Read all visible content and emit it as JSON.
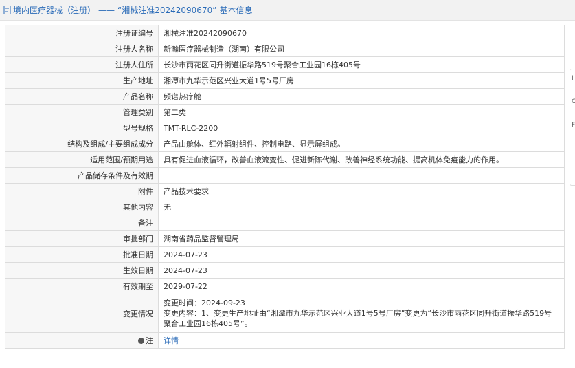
{
  "header": {
    "title": "境内医疗器械（注册）",
    "separator": "——",
    "reg_quoted": "“湘械注准20242090670”",
    "basic_info": "基本信息"
  },
  "rows": [
    {
      "label": "注册证编号",
      "value": "湘械注准20242090670"
    },
    {
      "label": "注册人名称",
      "value": "新瀚医疗器械制造（湖南）有限公司"
    },
    {
      "label": "注册人住所",
      "value": "长沙市雨花区同升街道振华路519号聚合工业园16栋405号"
    },
    {
      "label": "生产地址",
      "value": "湘潭市九华示范区兴业大道1号5号厂房"
    },
    {
      "label": "产品名称",
      "value": "频谱热疗舱"
    },
    {
      "label": "管理类别",
      "value": "第二类"
    },
    {
      "label": "型号规格",
      "value": "TMT-RLC-2200"
    },
    {
      "label": "结构及组成/主要组成成分",
      "value": "产品由舱体、红外辐射组件、控制电路、显示屏组成。"
    },
    {
      "label": "适用范围/预期用途",
      "value": "具有促进血液循环，改善血液流变性、促进新陈代谢、改善神经系统功能、提高机体免疫能力的作用。"
    },
    {
      "label": "产品储存条件及有效期",
      "value": ""
    },
    {
      "label": "附件",
      "value": "产品技术要求"
    },
    {
      "label": "其他内容",
      "value": "无"
    },
    {
      "label": "备注",
      "value": ""
    },
    {
      "label": "审批部门",
      "value": "湖南省药品监督管理局"
    },
    {
      "label": "批准日期",
      "value": "2024-07-23"
    },
    {
      "label": "生效日期",
      "value": "2024-07-23"
    },
    {
      "label": "有效期至",
      "value": "2029-07-22"
    }
  ],
  "change": {
    "label": "变更情况",
    "line1": "变更时间：2024-09-23",
    "line2": "变更内容：1、变更生产地址由“湘潭市九华示范区兴业大道1号5号厂房”变更为“长沙市雨花区同升街道振华路519号聚合工业园16栋405号”。"
  },
  "note": {
    "label": "注",
    "link": "详情"
  },
  "side_panel": {
    "letters": [
      "I",
      "C",
      "F"
    ]
  }
}
